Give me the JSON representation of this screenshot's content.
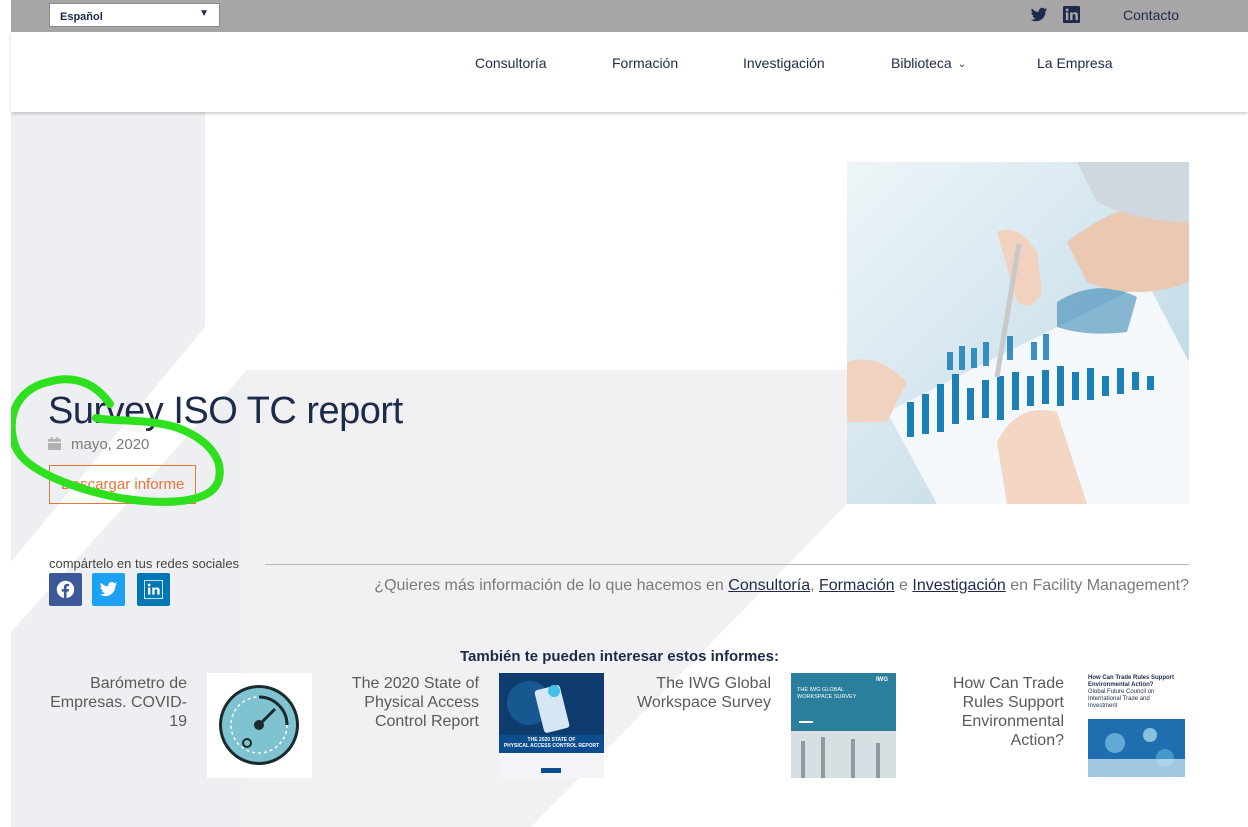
{
  "topbar": {
    "language": "Español",
    "icons": [
      "twitter-icon",
      "linkedin-icon"
    ],
    "contact": "Contacto",
    "bg_color": "#a7a5a7"
  },
  "nav": {
    "items": [
      "Consultoría",
      "Formación",
      "Investigación",
      "Biblioteca",
      "La Empresa"
    ]
  },
  "article": {
    "title": "Survey ISO TC report",
    "date": "mayo, 2020",
    "download_label": "Descargar informe",
    "accent_color": "#e8743a"
  },
  "share": {
    "label": "compártelo en tus redes sociales",
    "networks": [
      {
        "name": "facebook",
        "color": "#3b5998"
      },
      {
        "name": "twitter",
        "color": "#1da1f2"
      },
      {
        "name": "linkedin",
        "color": "#0077b5"
      }
    ]
  },
  "info": {
    "prefix": "¿Quieres más información de lo que hacemos en",
    "link1": "Consultoría",
    "sep1": ",",
    "link2": "Formación",
    "sep2": "e",
    "link3": "Investigación",
    "suffix": "en Facility Management?"
  },
  "related": {
    "title": "También te pueden interesar estos informes:",
    "cards": [
      {
        "title": "Barómetro de Empresas. COVID-19"
      },
      {
        "title": "The 2020 State of Physical Access Control Report",
        "thumb_text_1": "THE 2020 STATE OF",
        "thumb_text_2": "PHYSICAL ACCESS CONTROL REPORT"
      },
      {
        "title": "The IWG Global Workspace Survey",
        "thumb_text_1": "THE IWG GLOBAL",
        "thumb_text_2": "WORKSPACE SURVEY",
        "thumb_brand": "IWG"
      },
      {
        "title": "How Can Trade Rules Support Environmental Action?",
        "thumb_text_1": "How Can Trade Rules Support",
        "thumb_text_2": "Environmental Action?",
        "thumb_text_3": "Global Future Council on",
        "thumb_text_4": "International Trade and",
        "thumb_text_5": "Investment"
      }
    ]
  }
}
